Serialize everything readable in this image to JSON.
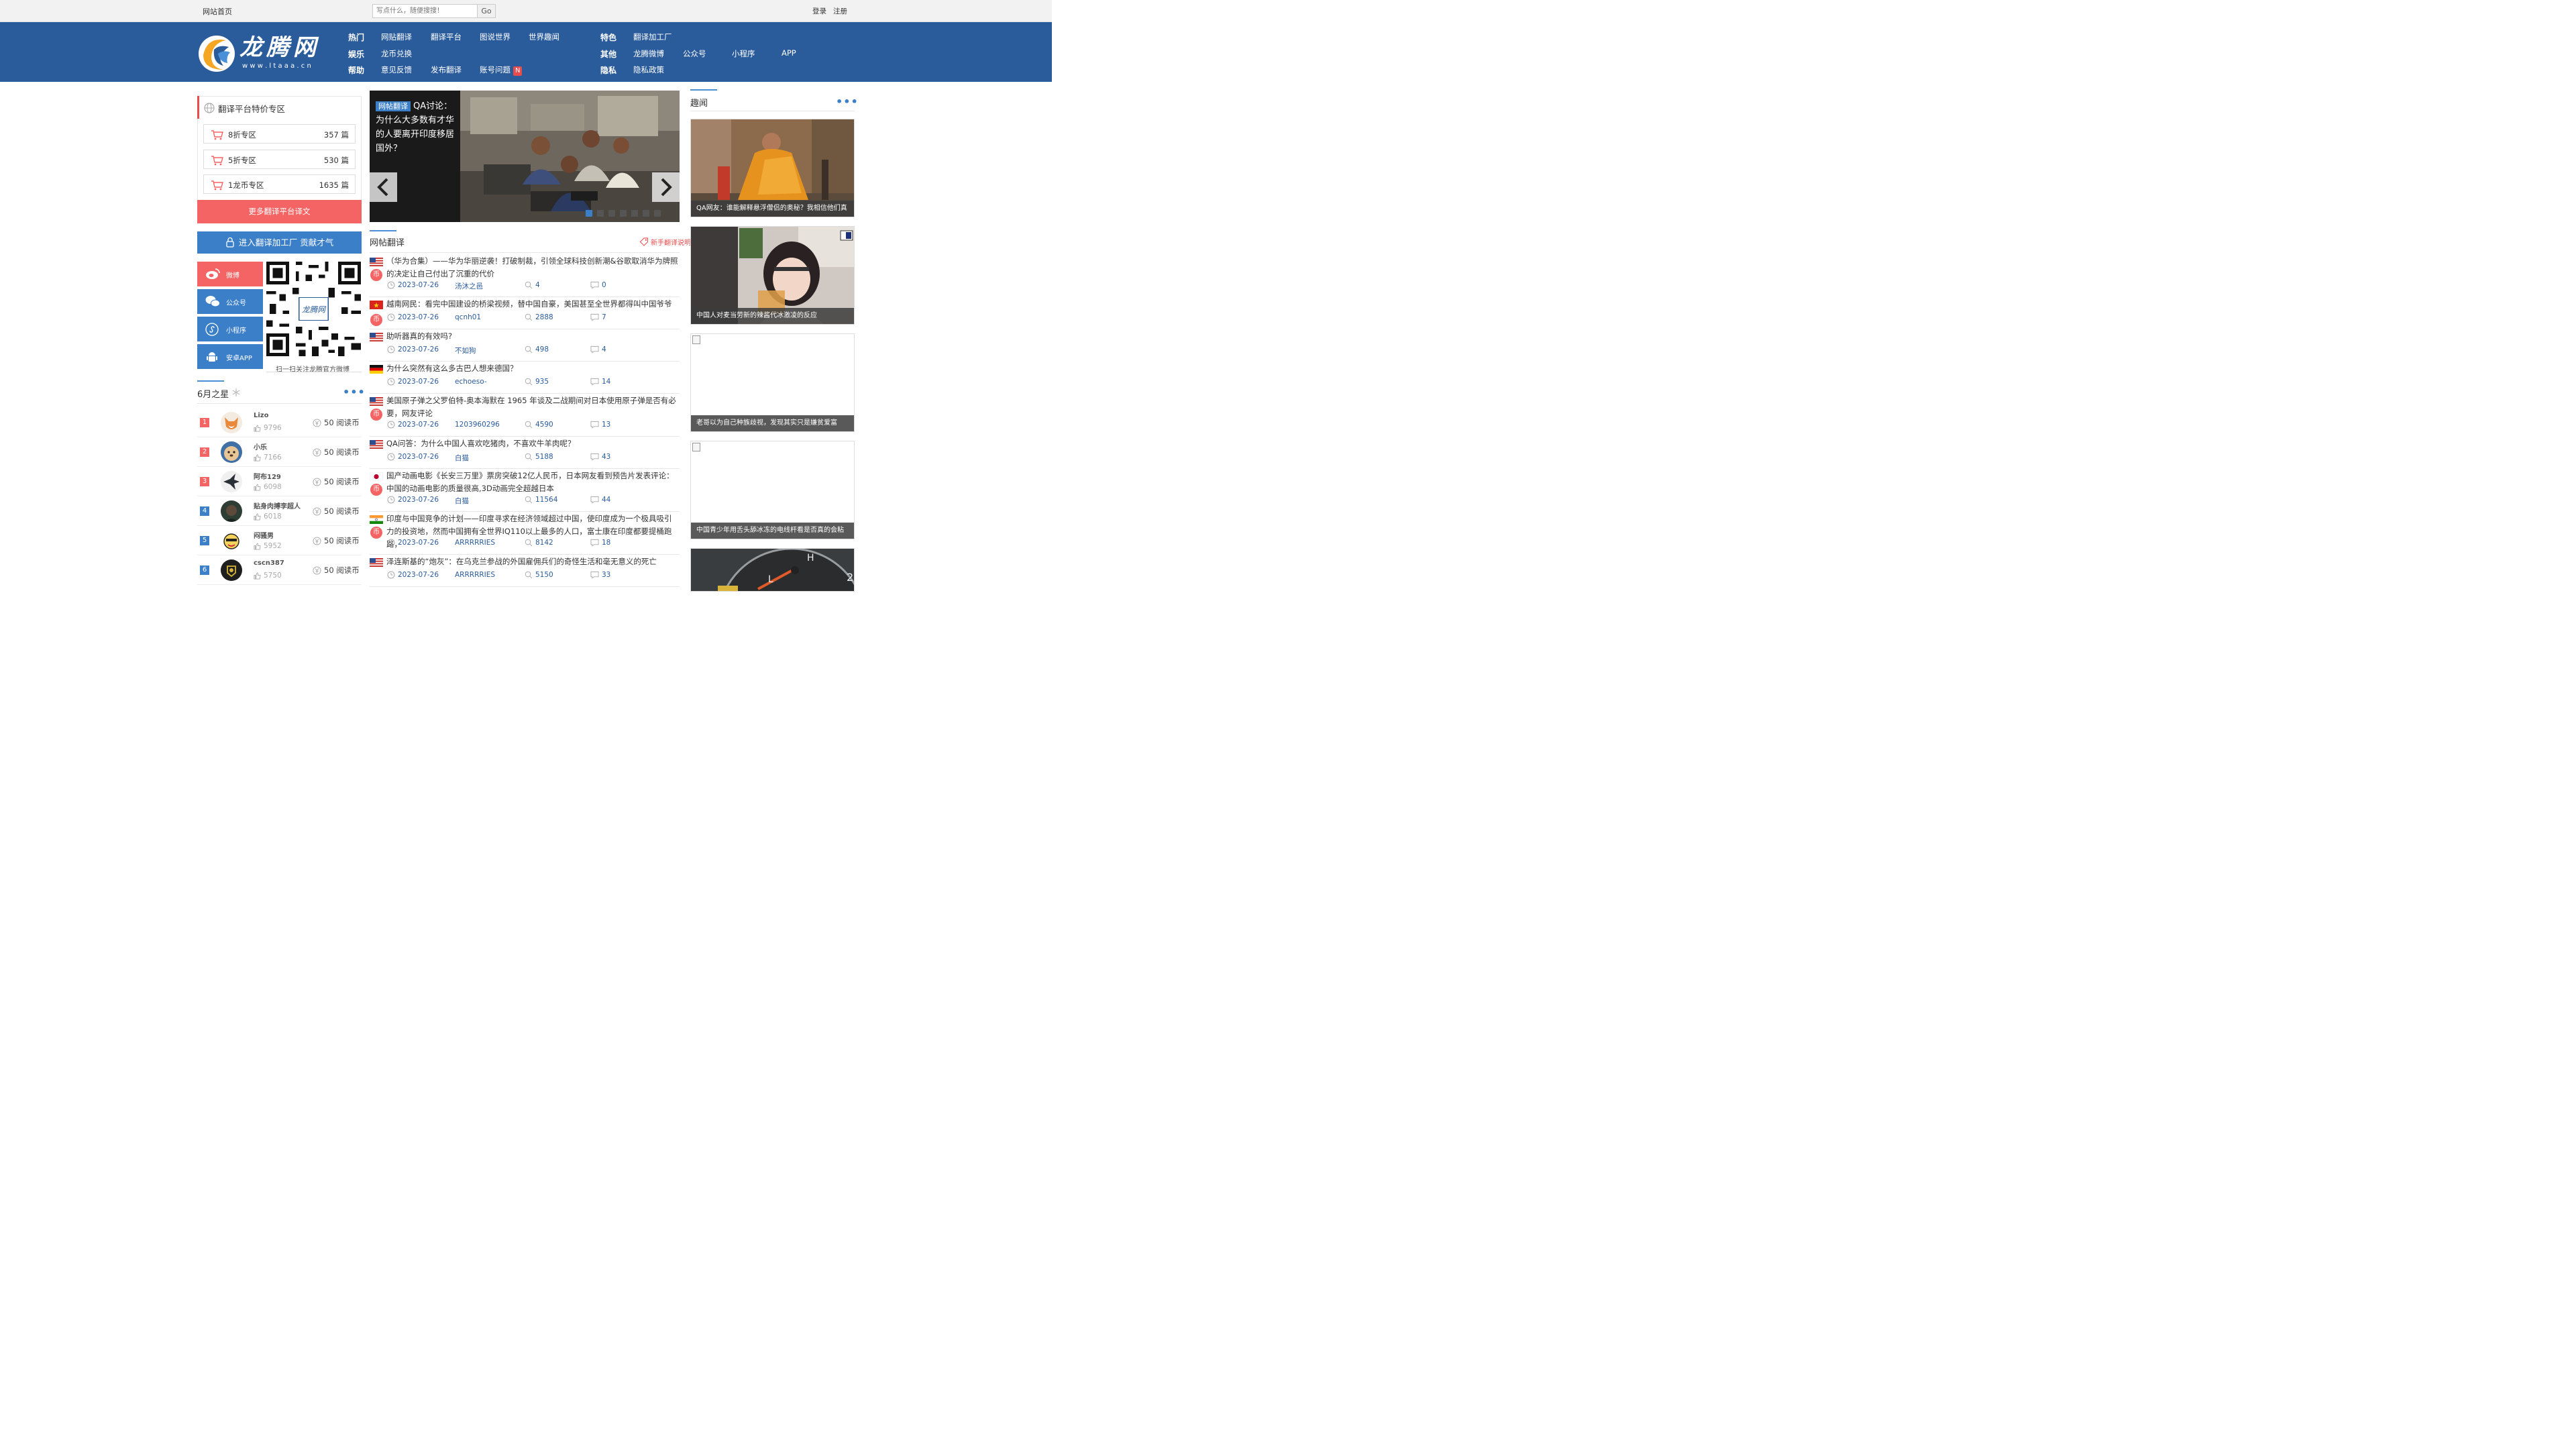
{
  "topbar": {
    "home": "网站首页",
    "search_placeholder": "写点什么，随便搜搜！",
    "search_button": "Go",
    "login": "登录",
    "register": "注册"
  },
  "logo": {
    "text": "龙腾网",
    "url_text": "w w w . l t a a a . c n"
  },
  "nav": {
    "hot": {
      "label": "热门",
      "links": [
        "网贴翻译",
        "翻译平台",
        "图说世界",
        "世界趣闻"
      ]
    },
    "fun": {
      "label": "娱乐",
      "links": [
        "龙币兑换"
      ]
    },
    "help": {
      "label": "帮助",
      "links": [
        "意见反馈",
        "发布翻译",
        "账号问题"
      ],
      "badge": "N"
    },
    "special": {
      "label": "特色",
      "links": [
        "翻译加工厂"
      ]
    },
    "other": {
      "label": "其他",
      "links": [
        "龙腾微博",
        "公众号",
        "小程序",
        "APP"
      ]
    },
    "privacy": {
      "label": "隐私",
      "links": [
        "隐私政策"
      ]
    }
  },
  "zone": {
    "title": "翻译平台特价专区",
    "items": [
      {
        "label": "8折专区",
        "count": "357 篇"
      },
      {
        "label": "5折专区",
        "count": "530 篇"
      },
      {
        "label": "1龙币专区",
        "count": "1635 篇"
      }
    ],
    "more": "更多翻译平台译文"
  },
  "factory": {
    "label": "进入翻译加工厂 贡献才气"
  },
  "social": {
    "items": [
      {
        "label": "微博",
        "color": "#f46464"
      },
      {
        "label": "公众号",
        "color": "#3c7fc9"
      },
      {
        "label": "小程序",
        "color": "#3c7fc9"
      },
      {
        "label": "安卓APP",
        "color": "#3c7fc9"
      }
    ],
    "qr_caption": "扫一扫关注龙腾官方微博"
  },
  "stars": {
    "title": "6月之星",
    "more": "•••",
    "rows": [
      {
        "rank": "1",
        "name": "Lizo",
        "likes": "9796",
        "coin": "50 阅读币",
        "rank_color": "#f46464",
        "avatar_color": "#e8893c"
      },
      {
        "rank": "2",
        "name": "小乐",
        "likes": "7166",
        "coin": "50 阅读币",
        "rank_color": "#f46464",
        "avatar_color": "#c9a46a"
      },
      {
        "rank": "3",
        "name": "阿布129",
        "likes": "6098",
        "coin": "50 阅读币",
        "rank_color": "#f46464",
        "avatar_color": "#2b2f38"
      },
      {
        "rank": "4",
        "name": "贴身肉搏李超人",
        "likes": "6018",
        "coin": "50 阅读币",
        "rank_color": "#3c7fc9",
        "avatar_color": "#2f3e35"
      },
      {
        "rank": "5",
        "name": "闷骚男",
        "likes": "5952",
        "coin": "50 阅读币",
        "rank_color": "#3c7fc9",
        "avatar_color": "#d9c36a"
      },
      {
        "rank": "6",
        "name": "cscn387",
        "likes": "5750",
        "coin": "50 阅读币",
        "rank_color": "#3c7fc9",
        "avatar_color": "#1e1e1e"
      }
    ]
  },
  "slider": {
    "tag": "网帖翻译",
    "caption": "QA讨论：为什么大多数有才华的人要离开印度移居国外？",
    "dots_total": 7,
    "active_dot": 0
  },
  "articles": {
    "section_title": "网帖翻译",
    "help_link": "新手翻译说明",
    "items": [
      {
        "flag": "us",
        "title": "（华为合集）——华为华丽逆袭！打破制裁，引领全球科技创新潮&谷歌取消华为牌照的决定让自己付出了沉重的代价",
        "date": "2023-07-26",
        "author": "汤沐之邑",
        "views": "4",
        "comments": "0",
        "coin": true
      },
      {
        "flag": "vn",
        "title": "越南网民：看完中国建设的桥梁视频，替中国自豪，美国甚至全世界都得叫中国爷爷",
        "date": "2023-07-26",
        "author": "qcnh01",
        "views": "2888",
        "comments": "7",
        "coin": true
      },
      {
        "flag": "us",
        "title": "助听器真的有效吗?",
        "date": "2023-07-26",
        "author": "不如狗",
        "views": "498",
        "comments": "4",
        "coin": false
      },
      {
        "flag": "de",
        "title": "为什么突然有这么多古巴人想来德国？",
        "date": "2023-07-26",
        "author": "echoeso-",
        "views": "935",
        "comments": "14",
        "coin": false
      },
      {
        "flag": "us",
        "title": "美国原子弹之父罗伯特-奥本海默在 1965 年谈及二战期间对日本使用原子弹是否有必要，网友评论",
        "date": "2023-07-26",
        "author": "1203960296",
        "views": "4590",
        "comments": "13",
        "coin": true
      },
      {
        "flag": "us",
        "title": "QA问答：为什么中国人喜欢吃猪肉，不喜欢牛羊肉呢？",
        "date": "2023-07-26",
        "author": "白猫",
        "views": "5188",
        "comments": "43",
        "coin": false
      },
      {
        "flag": "jp",
        "title": "国产动画电影《长安三万里》票房突破12亿人民币，日本网友看到预告片发表评论：中国的动画电影的质量很高,3D动画完全超越日本",
        "date": "2023-07-26",
        "author": "白猫",
        "views": "11564",
        "comments": "44",
        "coin": true
      },
      {
        "flag": "in",
        "title": "印度与中国竞争的计划——印度寻求在经济领域超过中国，使印度成为一个极具吸引力的投资地，然而中国拥有全世界IQ110以上最多的人口，富士康在印度都要提桶跑路，",
        "date": "2023-07-26",
        "author": "ARRRRRIES",
        "views": "8142",
        "comments": "18",
        "coin": true
      },
      {
        "flag": "us",
        "title": "泽连斯基的“炮灰”：在乌克兰参战的外国雇佣兵们的奇怪生活和毫无意义的死亡",
        "date": "2023-07-26",
        "author": "ARRRRRIES",
        "views": "5150",
        "comments": "33",
        "coin": false
      }
    ]
  },
  "news": {
    "title": "趣闻",
    "more": "•••",
    "cards": [
      {
        "caption": "QA网友：谁能解释悬浮僧侣的奥秘？我相信他们真",
        "kind": "monk"
      },
      {
        "caption": "中国人对麦当劳新的辣酱代冰激凌的反应",
        "kind": "girl"
      },
      {
        "caption": "老哥以为自己种族歧视，发现其实只是嫌贫爱富",
        "kind": "broken"
      },
      {
        "caption": "中国青少年用舌头舔冰冻的电线杆看是否真的会粘",
        "kind": "broken"
      },
      {
        "caption": "",
        "kind": "gauge"
      }
    ]
  }
}
